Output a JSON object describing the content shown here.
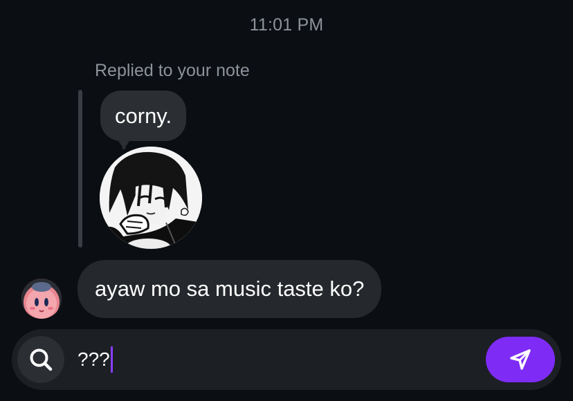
{
  "chat": {
    "timestamp": "11:01 PM",
    "reply_label": "Replied to your note",
    "note_text": "corny.",
    "message_text": "ayaw mo sa music taste ko?"
  },
  "composer": {
    "input_value": "???",
    "search_icon": "search-icon",
    "send_icon": "send-icon"
  },
  "colors": {
    "background": "#0b0e13",
    "bubble": "#25282d",
    "accent": "#7e2cf5",
    "muted_text": "#8e929a"
  }
}
